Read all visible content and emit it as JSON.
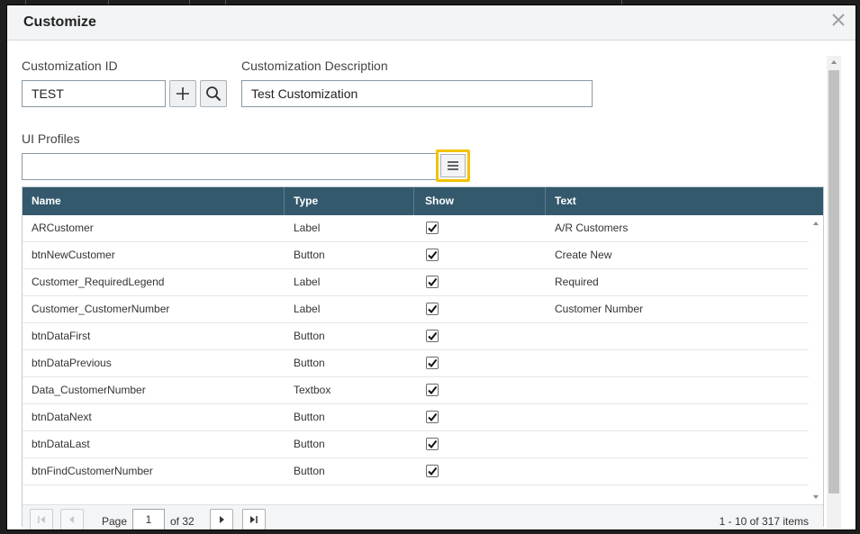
{
  "dialog": {
    "title": "Customize",
    "close_icon": "close-icon"
  },
  "form": {
    "customization_id_label": "Customization ID",
    "customization_id_value": "TEST",
    "customization_desc_label": "Customization Description",
    "customization_desc_value": "Test Customization",
    "ui_profiles_label": "UI Profiles",
    "ui_profiles_value": ""
  },
  "grid": {
    "columns": [
      "Name",
      "Type",
      "Show",
      "Text"
    ],
    "rows": [
      {
        "name": "ARCustomer",
        "type": "Label",
        "show": true,
        "text": "A/R Customers"
      },
      {
        "name": "btnNewCustomer",
        "type": "Button",
        "show": true,
        "text": "Create New"
      },
      {
        "name": "Customer_RequiredLegend",
        "type": "Label",
        "show": true,
        "text": "Required"
      },
      {
        "name": "Customer_CustomerNumber",
        "type": "Label",
        "show": true,
        "text": "Customer Number"
      },
      {
        "name": "btnDataFirst",
        "type": "Button",
        "show": true,
        "text": ""
      },
      {
        "name": "btnDataPrevious",
        "type": "Button",
        "show": true,
        "text": ""
      },
      {
        "name": "Data_CustomerNumber",
        "type": "Textbox",
        "show": true,
        "text": ""
      },
      {
        "name": "btnDataNext",
        "type": "Button",
        "show": true,
        "text": ""
      },
      {
        "name": "btnDataLast",
        "type": "Button",
        "show": true,
        "text": ""
      },
      {
        "name": "btnFindCustomerNumber",
        "type": "Button",
        "show": true,
        "text": ""
      }
    ]
  },
  "pager": {
    "page_label": "Page",
    "current_page": "1",
    "of_label": "of 32",
    "summary": "1 - 10 of 317 items"
  },
  "colors": {
    "header_bg": "#34596d",
    "highlight": "#f2c200"
  }
}
